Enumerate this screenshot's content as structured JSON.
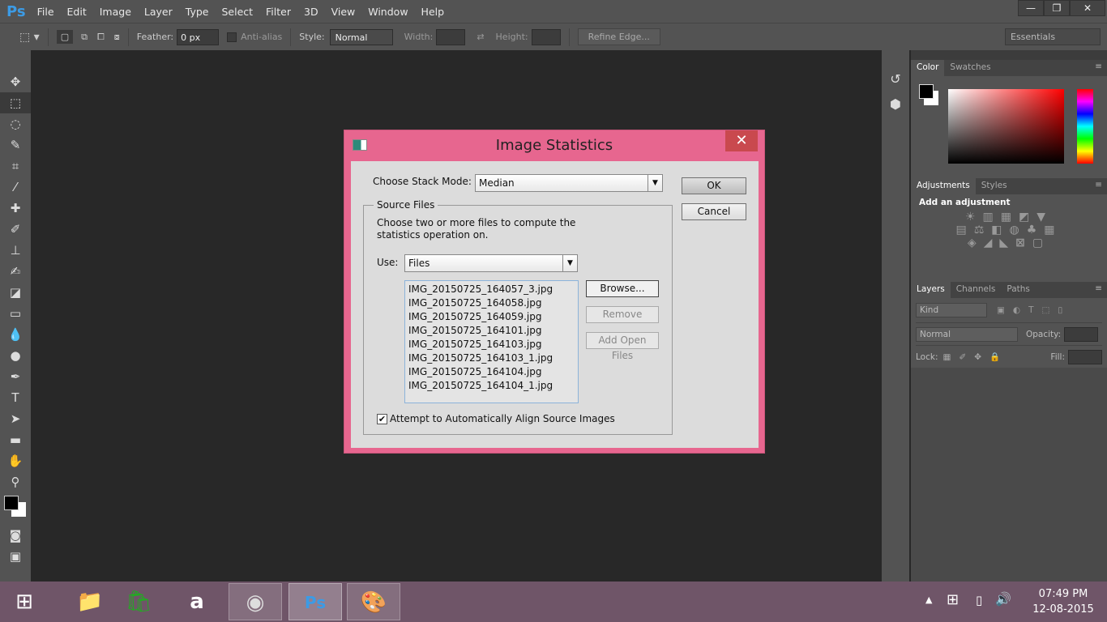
{
  "app": {
    "logo": "Ps",
    "menu": [
      "File",
      "Edit",
      "Image",
      "Layer",
      "Type",
      "Select",
      "Filter",
      "3D",
      "View",
      "Window",
      "Help"
    ],
    "window_controls": [
      "minimize",
      "restore",
      "close"
    ]
  },
  "options_bar": {
    "feather_label": "Feather:",
    "feather_value": "0 px",
    "antialias_label": "Anti-alias",
    "style_label": "Style:",
    "style_value": "Normal",
    "width_label": "Width:",
    "height_label": "Height:",
    "refine_edge": "Refine Edge...",
    "workspace": "Essentials"
  },
  "tools": [
    "move",
    "rectangular-marquee",
    "lasso",
    "quick-selection",
    "crop",
    "eyedropper",
    "spot-healing",
    "brush",
    "clone-stamp",
    "history-brush",
    "eraser",
    "gradient",
    "blur",
    "dodge",
    "pen",
    "type",
    "path-selection",
    "rectangle",
    "hand",
    "zoom"
  ],
  "panels": {
    "color": {
      "tabs": [
        "Color",
        "Swatches"
      ],
      "foreground": "#000000",
      "background": "#ffffff"
    },
    "adjustments": {
      "tabs": [
        "Adjustments",
        "Styles"
      ],
      "heading": "Add an adjustment"
    },
    "layers": {
      "tabs": [
        "Layers",
        "Channels",
        "Paths"
      ],
      "filter": "Kind",
      "blend_mode": "Normal",
      "opacity_label": "Opacity:",
      "lock_label": "Lock:",
      "fill_label": "Fill:"
    }
  },
  "dialog": {
    "title": "Image Statistics",
    "stack_mode_label": "Choose Stack Mode:",
    "stack_mode_value": "Median",
    "ok": "OK",
    "cancel": "Cancel",
    "group_label": "Source Files",
    "description": "Choose two or more files to compute the statistics operation on.",
    "use_label": "Use:",
    "use_value": "Files",
    "files": [
      "IMG_20150725_164057_3.jpg",
      "IMG_20150725_164058.jpg",
      "IMG_20150725_164059.jpg",
      "IMG_20150725_164101.jpg",
      "IMG_20150725_164103.jpg",
      "IMG_20150725_164103_1.jpg",
      "IMG_20150725_164104.jpg",
      "IMG_20150725_164104_1.jpg"
    ],
    "browse": "Browse...",
    "remove": "Remove",
    "add_open_files": "Add Open Files",
    "align_label": "Attempt to Automatically Align Source Images",
    "align_checked": true
  },
  "taskbar": {
    "apps": [
      "file-explorer",
      "store",
      "amazon",
      "chrome",
      "photoshop",
      "paint"
    ],
    "time": "07:49 PM",
    "date": "12-08-2015"
  }
}
